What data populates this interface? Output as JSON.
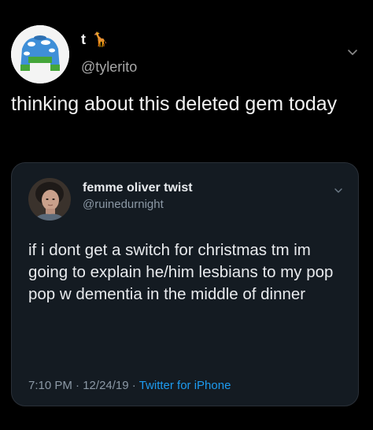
{
  "outer_tweet": {
    "display_name": "t 🦒",
    "handle": "@tylerito",
    "text": "thinking about this deleted gem today",
    "icons": {
      "avatar": "sweater-avatar",
      "menu": "chevron-down-icon"
    }
  },
  "quoted_tweet": {
    "display_name": "femme oliver twist",
    "handle": "@ruinedurnight",
    "text": "if i dont get a switch for christmas tm im going to explain he/him lesbians to my pop pop w dementia in the middle of dinner",
    "time": "7:10 PM",
    "date": "12/24/19",
    "separator": "·",
    "source": "Twitter for iPhone",
    "icons": {
      "avatar": "user-photo-avatar",
      "menu": "chevron-down-icon"
    }
  },
  "colors": {
    "background": "#000000",
    "card_background": "#141b22",
    "card_border": "#2a3038",
    "primary_text": "#e8eaed",
    "secondary_text": "#8b98a5",
    "link": "#1d9bf0"
  }
}
